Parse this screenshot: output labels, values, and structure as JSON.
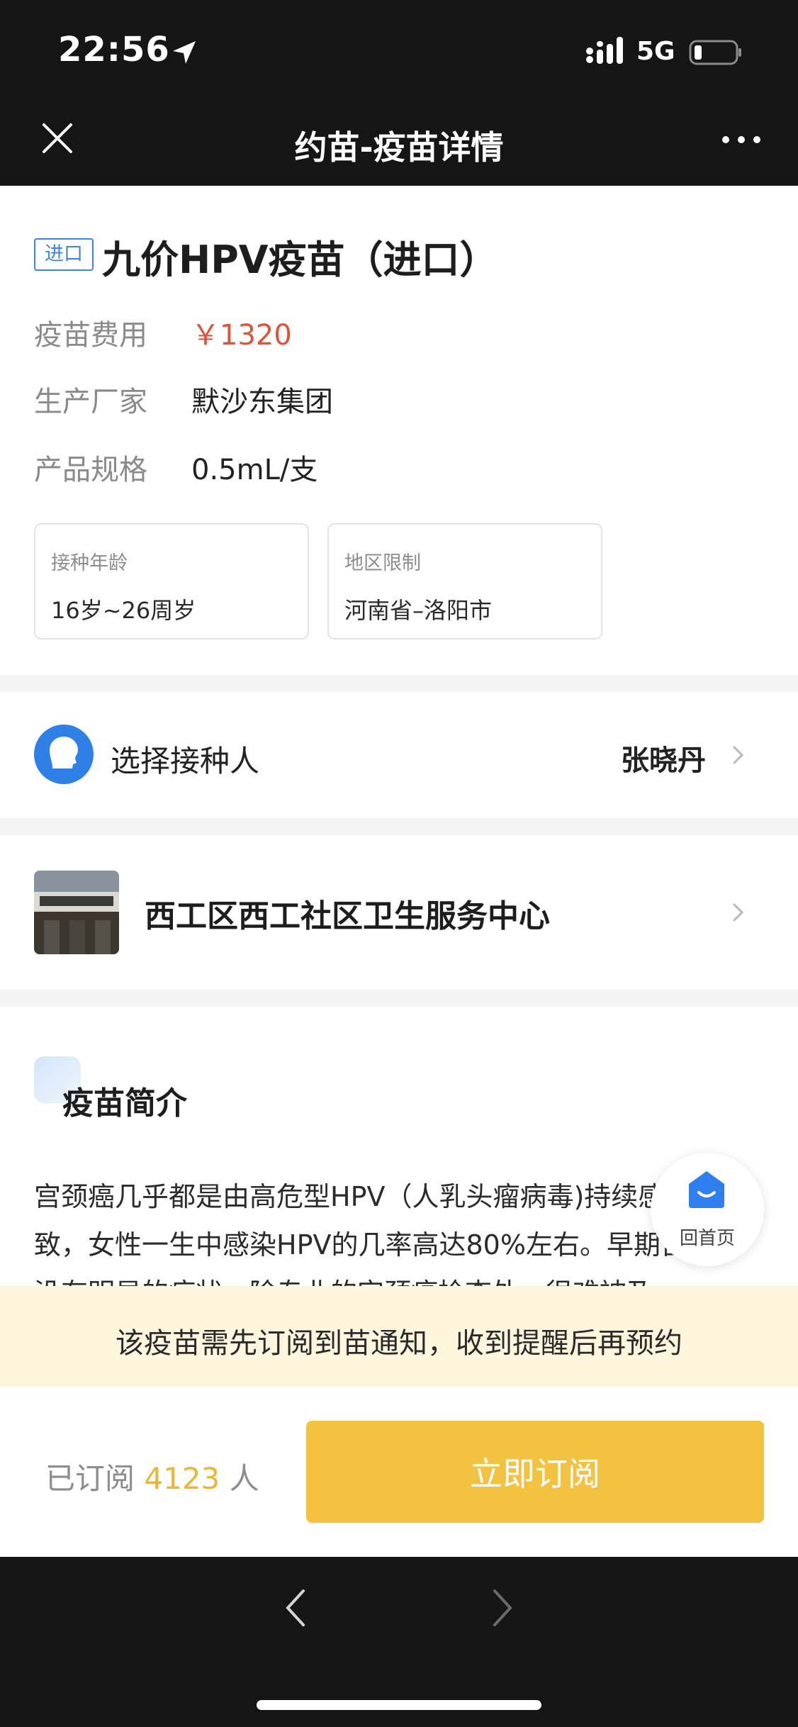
{
  "status_bar": {
    "time": "22:56",
    "network": "5G"
  },
  "nav": {
    "title": "约苗-疫苗详情"
  },
  "vaccine": {
    "tag": "进口",
    "name": "九价HPV疫苗（进口）",
    "fields": [
      {
        "label": "疫苗费用",
        "value": "￥1320"
      },
      {
        "label": "生产厂家",
        "value": "默沙东集团"
      },
      {
        "label": "产品规格",
        "value": "0.5mL/支"
      }
    ],
    "boxes": [
      {
        "label": "接种年龄",
        "value": "16岁~26周岁"
      },
      {
        "label": "地区限制",
        "value": "河南省–洛阳市"
      }
    ]
  },
  "recipient": {
    "label": "选择接种人",
    "name": "张晓丹"
  },
  "site": {
    "name": "西工区西工社区卫生服务中心"
  },
  "intro": {
    "title": "疫苗简介",
    "text": "宫颈癌几乎都是由高危型HPV（人乳头瘤病毒)持续感染导致，女性一生中感染HPV的几率高达80%左右。早期宫颈癌没有明显的症状，除专业的宫颈癌检查外，很难被及"
  },
  "home_button": {
    "label": "回首页"
  },
  "notice": {
    "text": "该疫苗需先订阅到苗通知，收到提醒后再预约"
  },
  "subscription": {
    "prefix": "已订阅",
    "count": "4123",
    "suffix": "人",
    "button_label": "立即订阅"
  },
  "colors": {
    "accent_blue": "#3b87d9",
    "price_red": "#e0533a",
    "button_yellow": "#f4c241",
    "notice_bg": "#fdf6dc"
  }
}
